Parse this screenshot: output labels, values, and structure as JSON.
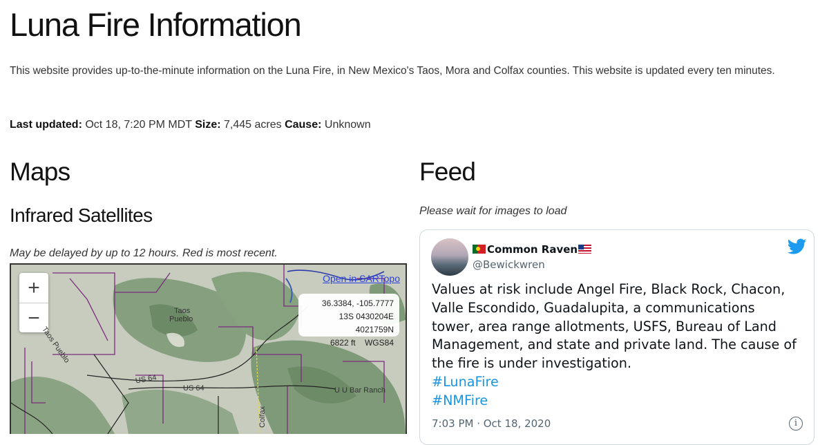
{
  "header": {
    "title": "Luna Fire Information",
    "intro": "This website provides up-to-the-minute information on the Luna Fire, in New Mexico's Taos, Mora and Colfax counties. This website is updated every ten minutes."
  },
  "status": {
    "updated_label": "Last updated:",
    "updated_value": "Oct 18, 7:20 PM MDT",
    "size_label": "Size:",
    "size_value": "7,445 acres",
    "cause_label": "Cause:",
    "cause_value": "Unknown"
  },
  "maps": {
    "heading": "Maps",
    "subheading": "Infrared Satellites",
    "note": "May be delayed by up to 12 hours. Red is most recent.",
    "zoom_in": "+",
    "zoom_out": "−",
    "open_link": "Open in SARTopo",
    "coords": {
      "latlon": "36.3384, -105.7777",
      "utm": "13S 0430204E 4021759N",
      "elev": "6822 ft",
      "datum": "WGS84"
    },
    "labels": {
      "taos_pueblo_1": "Taos",
      "taos_pueblo_2": "Pueblo",
      "taos_pueblo_diag": "Taos Pueblo",
      "us64_a": "US 64",
      "us64_b": "US 64",
      "ubar": "U U Bar Ranch",
      "colfax": "Colfax"
    }
  },
  "feed": {
    "heading": "Feed",
    "note": "Please wait for images to load",
    "tweet": {
      "name": "Common Raven",
      "handle": "@Bewickwren",
      "text": "Values at risk include Angel Fire, Black Rock, Chacon, Valle Escondido, Guadalupita, a communications tower, area range allotments, USFS, Bureau of Land Management, and state and private land. The cause of the fire is under investigation.",
      "hashtags": [
        "#LunaFire",
        "#NMFire"
      ],
      "timestamp": "7:03 PM · Oct 18, 2020",
      "info": "i"
    }
  },
  "colors": {
    "link_blue": "#1b95e0",
    "map_link": "#2a3fe0",
    "boundary_purple": "#7b2a7e"
  }
}
